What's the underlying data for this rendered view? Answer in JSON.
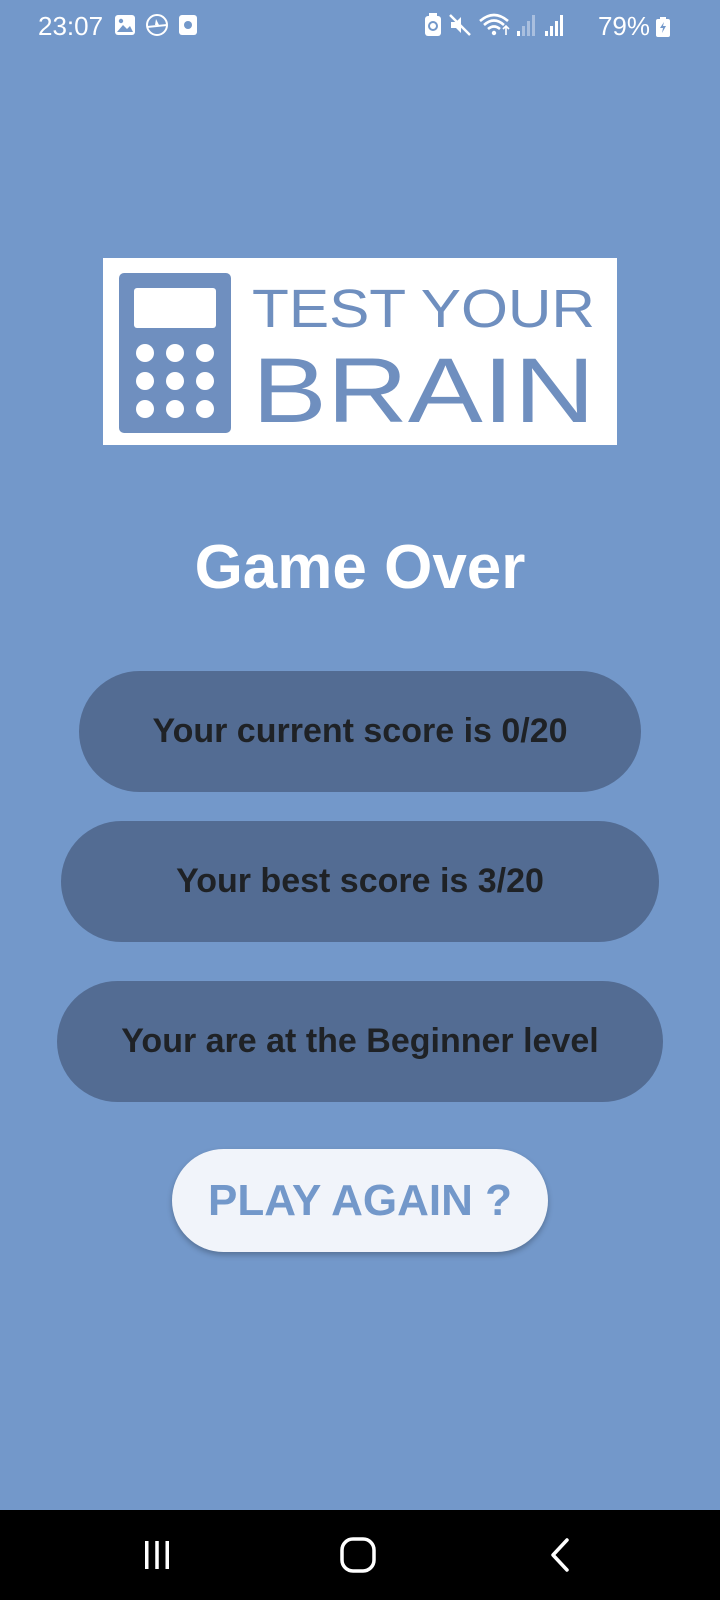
{
  "status_bar": {
    "time": "23:07",
    "battery_percent": "79%",
    "left_icons": [
      "gallery-icon",
      "airplane-app-icon",
      "media-icon"
    ],
    "right_icons": [
      "battery-saver-icon",
      "mute-icon",
      "wifi-icon",
      "signal-icon-1",
      "signal-icon-2",
      "battery-charging-icon"
    ]
  },
  "logo": {
    "line1": "TEST YOUR",
    "line2": "BRAIN",
    "icon": "calculator-icon"
  },
  "title": "Game Over",
  "scores": {
    "current": "Your current score is 0/20",
    "best": "Your best score is 3/20",
    "level": "Your are at the Beginner level"
  },
  "play_again_label": "PLAY AGAIN ?",
  "nav": {
    "recents": "recents-icon",
    "home": "home-icon",
    "back": "back-icon"
  },
  "colors": {
    "background": "#7398ca",
    "pill": "#536c93",
    "pill_text": "#1f2226",
    "button_bg": "#f1f4fa",
    "button_text": "#7398ca",
    "logo_blue": "#6f8fbf"
  }
}
